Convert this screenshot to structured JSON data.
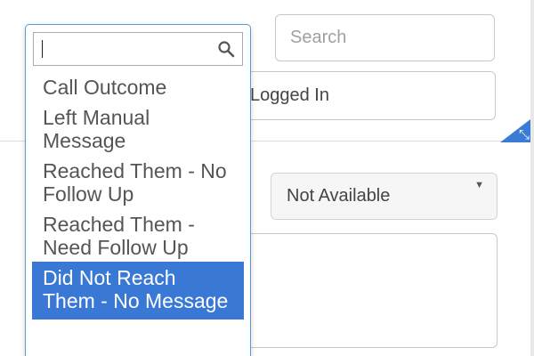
{
  "search": {
    "placeholder": "Search"
  },
  "status_field": {
    "value": "Logged In"
  },
  "availability": {
    "selected": "Not Available"
  },
  "dropdown": {
    "search_value": "",
    "options": [
      {
        "label": "Call Outcome"
      },
      {
        "label": "Left Manual Message"
      },
      {
        "label": "Reached Them - No Follow Up"
      },
      {
        "label": "Reached Them - Need Follow Up"
      },
      {
        "label": "Did Not Reach Them - No Message"
      }
    ],
    "highlighted_index": 4
  },
  "colors": {
    "highlight": "#3a78d6",
    "dropdown_border": "#5b9bd5",
    "resize_corner": "#3a7bd5"
  },
  "icons": {
    "dropdown_search": "search-icon",
    "select_caret": "caret-down-icon",
    "resize": "resize-arrows-icon"
  }
}
